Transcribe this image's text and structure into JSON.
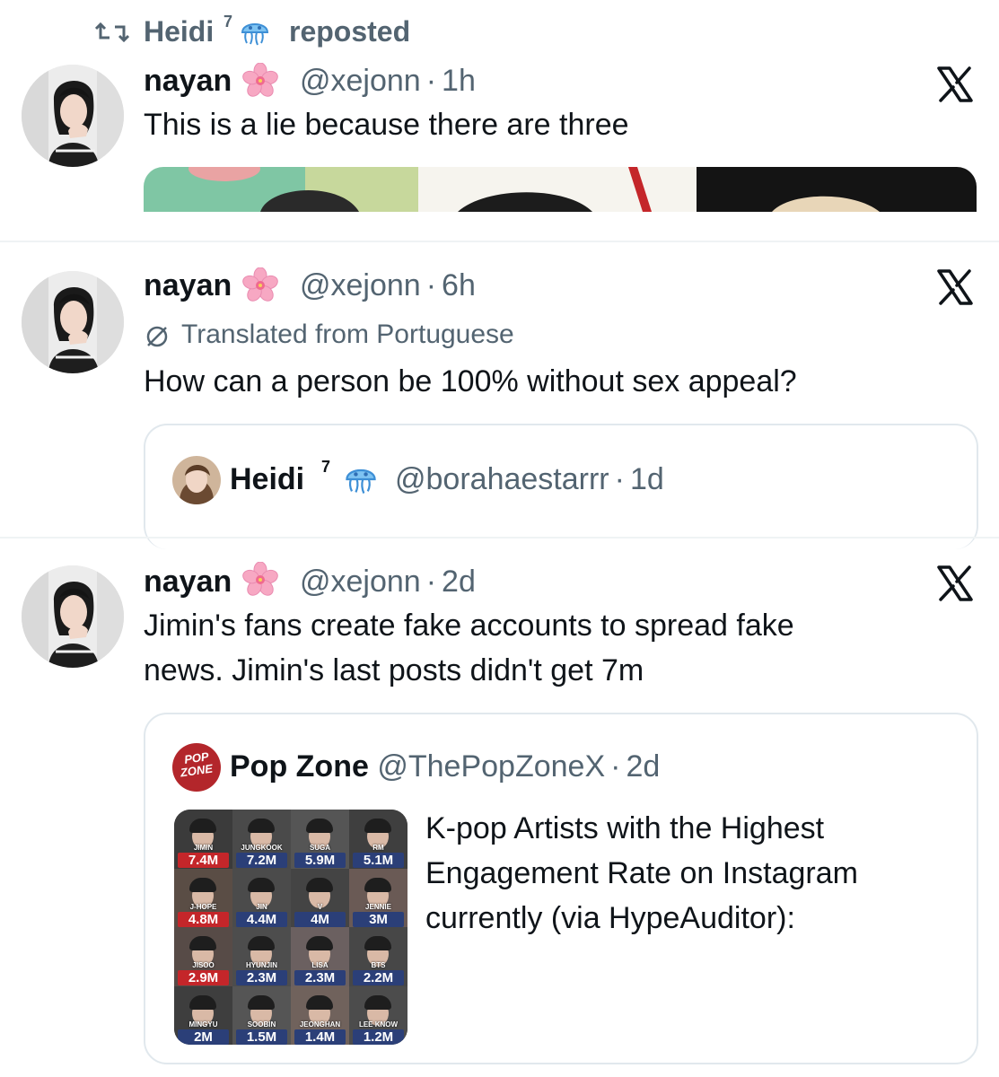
{
  "repost_header": {
    "user": "Heidi",
    "superscript": "7",
    "label": "reposted"
  },
  "posts": [
    {
      "author": "nayan",
      "handle": "@xejonn",
      "time": "1h",
      "text_lines": [
        "This is a lie because there are three"
      ]
    },
    {
      "author": "nayan",
      "handle": "@xejonn",
      "time": "6h",
      "translated": "Translated from Portuguese",
      "text_lines": [
        "How can a person be 100% without sex appeal?"
      ],
      "quote": {
        "author": "Heidi",
        "superscript": "7",
        "handle": "@borahaestarrr",
        "time": "1d"
      }
    },
    {
      "author": "nayan",
      "handle": "@xejonn",
      "time": "2d",
      "text_lines": [
        "Jimin's fans create fake accounts to spread fake",
        "news. Jimin's last posts didn't get 7m"
      ],
      "quote": {
        "author": "Pop Zone",
        "handle": "@ThePopZoneX",
        "time": "2d",
        "avatar_text": [
          "POP",
          "ZONE"
        ],
        "text_lines": [
          "K-pop Artists with the Highest",
          "Engagement Rate on Instagram",
          "currently (via HypeAuditor):"
        ],
        "grid": [
          {
            "name": "JIMIN",
            "value": "7.4M"
          },
          {
            "name": "JUNGKOOK",
            "value": "7.2M"
          },
          {
            "name": "SUGA",
            "value": "5.9M"
          },
          {
            "name": "RM",
            "value": "5.1M"
          },
          {
            "name": "J-HOPE",
            "value": "4.8M"
          },
          {
            "name": "JIN",
            "value": "4.4M"
          },
          {
            "name": "V",
            "value": "4M"
          },
          {
            "name": "JENNIE",
            "value": "3M"
          },
          {
            "name": "JISOO",
            "value": "2.9M"
          },
          {
            "name": "HYUNJIN",
            "value": "2.3M"
          },
          {
            "name": "LISA",
            "value": "2.3M"
          },
          {
            "name": "BTS",
            "value": "2.2M"
          },
          {
            "name": "MINGYU",
            "value": "2M"
          },
          {
            "name": "SOOBIN",
            "value": "1.5M"
          },
          {
            "name": "JEONGHAN",
            "value": "1.4M"
          },
          {
            "name": "LEE KNOW",
            "value": "1.2M"
          }
        ]
      }
    }
  ],
  "separator": "·",
  "icons": {
    "repost": "repost-icon",
    "blossom": "cherry-blossom-emoji",
    "jellyfish": "jellyfish-emoji",
    "translate": "translate-icon",
    "x": "x-logo-icon"
  },
  "colors": {
    "text": "#0f1419",
    "secondary": "#536471",
    "border": "#e1e8ed",
    "popzone_red": "#b3262b"
  }
}
